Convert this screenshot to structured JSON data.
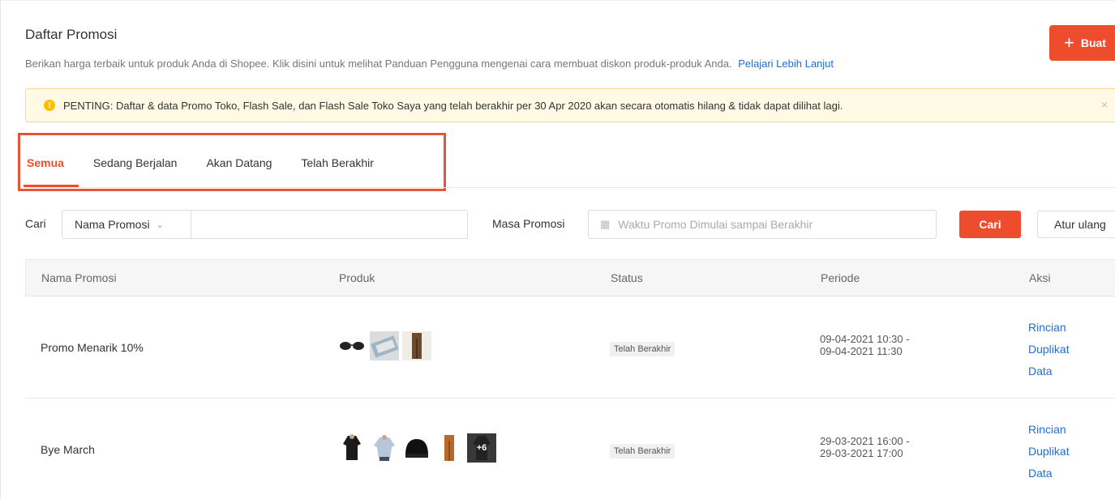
{
  "header": {
    "title": "Daftar Promosi",
    "subtitle": "Berikan harga terbaik untuk produk Anda di Shopee. Klik disini untuk melihat Panduan Pengguna mengenai cara membuat diskon produk-produk Anda.",
    "learn_more": "Pelajari Lebih Lanjut",
    "create_label": "Buat"
  },
  "alert": {
    "text": "PENTING: Daftar & data Promo Toko, Flash Sale, dan Flash Sale Toko Saya yang telah berakhir per 30 Apr 2020 akan secara otomatis hilang & tidak dapat dilihat lagi.",
    "close": "×"
  },
  "tabs": [
    {
      "label": "Semua",
      "active": true
    },
    {
      "label": "Sedang Berjalan",
      "active": false
    },
    {
      "label": "Akan Datang",
      "active": false
    },
    {
      "label": "Telah Berakhir",
      "active": false
    }
  ],
  "search": {
    "label": "Cari",
    "field_select": "Nama Promosi",
    "input_value": "",
    "period_label": "Masa Promosi",
    "period_placeholder": "Waktu Promo Dimulai sampai Berakhir",
    "search_button": "Cari",
    "reset_button": "Atur ulang"
  },
  "table": {
    "headers": {
      "name": "Nama Promosi",
      "products": "Produk",
      "status": "Status",
      "period": "Periode",
      "actions": "Aksi"
    },
    "rows": [
      {
        "name": "Promo Menarik 10%",
        "status": "Telah Berakhir",
        "period_start": "09-04-2021 10:30 -",
        "period_end": "09-04-2021 11:30",
        "actions": [
          "Rincian",
          "Duplikat",
          "Data"
        ],
        "more_count": ""
      },
      {
        "name": "Bye March",
        "status": "Telah Berakhir",
        "period_start": "29-03-2021 16:00 -",
        "period_end": "29-03-2021 17:00",
        "actions": [
          "Rincian",
          "Duplikat",
          "Data"
        ],
        "more_count": "+6"
      }
    ]
  },
  "colors": {
    "accent": "#ee4d2d",
    "link": "#1d6fd8",
    "alert_bg": "#fff9e6",
    "alert_icon": "#ffbf00"
  }
}
